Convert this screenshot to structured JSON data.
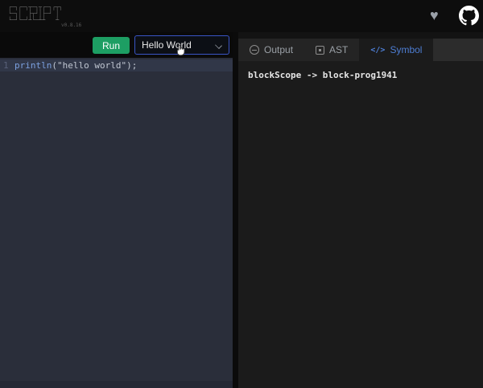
{
  "header": {
    "logo_art_line1": "┌─┐┌─┐┬─┐┬┌─┐┌┬┐",
    "logo_art_line2": "└─┐│  ├┬┘│├─┘ │ ",
    "logo_art_line3": "└─┘└─┘┴└─┴┴   ┴ ",
    "version": "v0.8.16",
    "heart_icon": "♥"
  },
  "toolbar": {
    "run_label": "Run",
    "example_dropdown": {
      "value": "Hello World"
    }
  },
  "editor": {
    "line_number": "1",
    "code": {
      "fn": "println",
      "open": "(",
      "str": "\"hello world\"",
      "close": ");"
    }
  },
  "tabs": {
    "output_label": "Output",
    "ast_label": "AST",
    "symbol_label": "Symbol",
    "symbol_icon": "</>"
  },
  "symbol_panel": {
    "line": "blockScope -> block-prog1941"
  },
  "colors": {
    "run_green": "#1d9e63",
    "dropdown_border_blue": "#3a55c6",
    "selected_tab_blue": "#4d7dd2",
    "editor_bg": "#2a2e3a"
  }
}
